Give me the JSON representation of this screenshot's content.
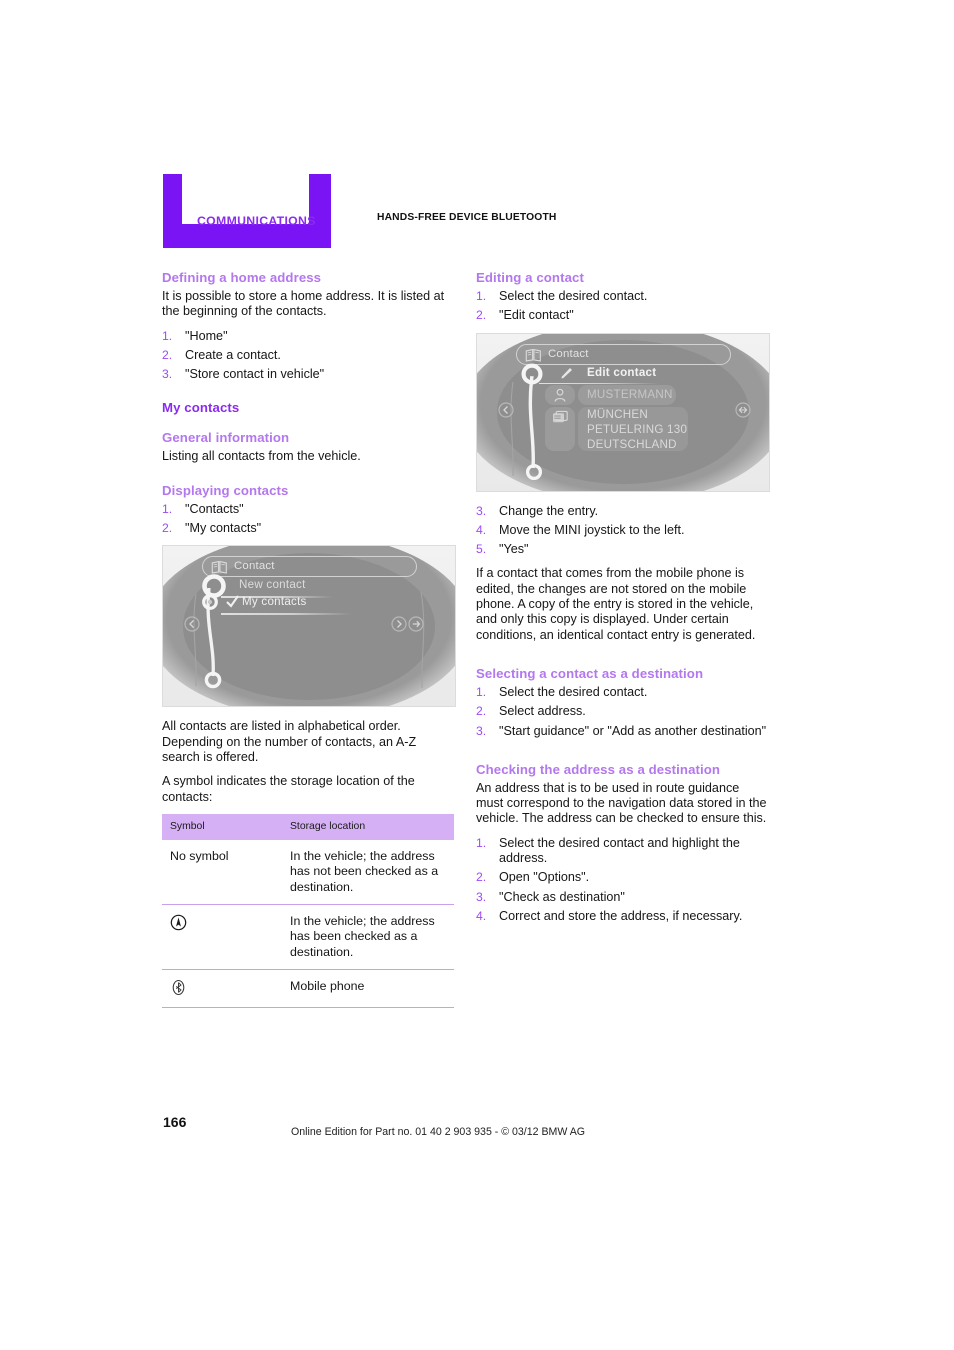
{
  "header": {
    "chapter": "COMMUNICATIONS",
    "section": "HANDS-FREE DEVICE BLUETOOTH"
  },
  "colors": {
    "banner": "#7A14F5",
    "chapter_text": "#8A2BF0",
    "section_heading": "#8A2BF0",
    "sub_heading": "#B377EE",
    "list_number": "#9D4BF2",
    "table_header_bg": "#D6B0F4",
    "table_rule": "#C9A0EC",
    "body_text": "#161616"
  },
  "left_column": {
    "defining_home": {
      "heading": "Defining a home address",
      "intro": "It is possible to store a home address. It is listed at the beginning of the contacts.",
      "steps": [
        "\"Home\"",
        "Create a contact.",
        "\"Store contact in vehicle\""
      ]
    },
    "my_contacts": {
      "heading": "My contacts"
    },
    "general_information": {
      "heading": "General information",
      "text": "Listing all contacts from the vehicle."
    },
    "displaying_contacts": {
      "heading": "Displaying contacts",
      "steps": [
        "\"Contacts\"",
        "\"My contacts\""
      ]
    },
    "screenshot_contacts": {
      "title": "Contact",
      "title_icon": "address-book-icon",
      "rows": [
        {
          "label": "New contact",
          "checked": false
        },
        {
          "label": "My contacts",
          "checked": true
        }
      ],
      "nav_left_icon": "back-arrow-icon",
      "nav_right_icons": [
        "forward-arrow-icon",
        "options-arrow-icon"
      ]
    },
    "after_screenshot": [
      "All contacts are listed in alphabetical order. Depending on the number of contacts, an A-Z search is offered.",
      "A symbol indicates the storage location of the contacts:"
    ],
    "table": {
      "headers": [
        "Symbol",
        "Storage location"
      ],
      "rows": [
        {
          "symbol": "No symbol",
          "symbol_icon": null,
          "location": "In the vehicle; the address has not been checked as a destination."
        },
        {
          "symbol": "",
          "symbol_icon": "navigation-checked-icon",
          "location": "In the vehicle; the address has been checked as a destination."
        },
        {
          "symbol": "",
          "symbol_icon": "bluetooth-icon",
          "location": "Mobile phone"
        }
      ]
    }
  },
  "right_column": {
    "editing_contact": {
      "heading": "Editing a contact",
      "steps_before": [
        "Select the desired contact.",
        "\"Edit contact\""
      ],
      "steps_after": [
        "Change the entry.",
        "Move the MINI joystick to the left.",
        "\"Yes\""
      ],
      "note": "If a contact that comes from the mobile phone is edited, the changes are not stored on the mobile phone. A copy of the entry is stored in the vehicle, and only this copy is displayed. Under certain conditions, an identical contact entry is generated."
    },
    "screenshot_edit": {
      "title": "Contact",
      "title_icon": "address-book-icon",
      "menu_item": "Edit contact",
      "menu_item_icon": "pencil-icon",
      "name": "MUSTERMANN",
      "name_icon": "person-icon",
      "address_icon": "address-card-icon",
      "address_lines": [
        "MÜNCHEN",
        "PETUELRING 130",
        "DEUTSCHLAND"
      ],
      "nav_left_icon": "back-arrow-icon",
      "nav_right_icon": "options-arrow-icon"
    },
    "selecting_destination": {
      "heading": "Selecting a contact as a destination",
      "steps": [
        "Select the desired contact.",
        "Select address.",
        "\"Start guidance\" or \"Add as another destination\""
      ]
    },
    "checking_address": {
      "heading": "Checking the address as a destination",
      "intro": "An address that is to be used in route guidance must correspond to the navigation data stored in the vehicle. The address can be checked to ensure this.",
      "steps": [
        "Select the desired contact and highlight the address.",
        "Open \"Options\".",
        "\"Check as destination\"",
        "Correct and store the address, if necessary."
      ]
    }
  },
  "footer": {
    "page_number": "166",
    "note": "Online Edition for Part no. 01 40 2 903 935 - © 03/12 BMW AG"
  }
}
